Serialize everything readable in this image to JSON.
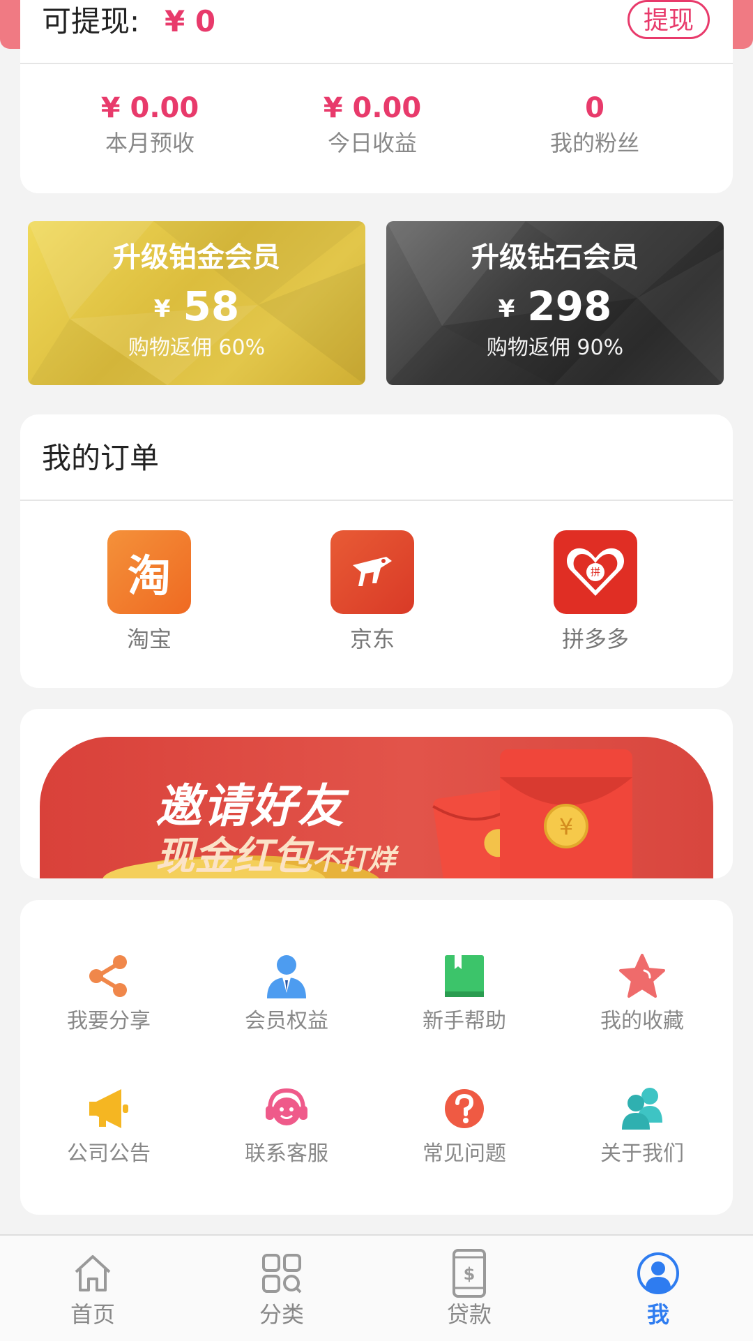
{
  "header": {
    "withdraw_label": "可提现:",
    "withdraw_amount": "¥ 0",
    "withdraw_button": "提现"
  },
  "stats": [
    {
      "value": "¥ 0.00",
      "label": "本月预收"
    },
    {
      "value": "¥ 0.00",
      "label": "今日收益"
    },
    {
      "value": "0",
      "label": "我的粉丝"
    }
  ],
  "memberships": [
    {
      "title": "升级铂金会员",
      "currency": "¥",
      "price": "58",
      "rebate": "购物返佣 60%"
    },
    {
      "title": "升级钻石会员",
      "currency": "¥",
      "price": "298",
      "rebate": "购物返佣 90%"
    }
  ],
  "orders": {
    "title": "我的订单",
    "shops": [
      {
        "name": "淘宝",
        "icon": "taobao-icon",
        "color": "#f37b2b",
        "glyph": "淘"
      },
      {
        "name": "京东",
        "icon": "jd-icon",
        "color": "#e0492f"
      },
      {
        "name": "拼多多",
        "icon": "pinduoduo-icon",
        "color": "#e02e24",
        "glyph": "拼"
      }
    ]
  },
  "invite": {
    "line1": "邀请好友",
    "line2": "现金红包",
    "line2_suffix": "不打烊",
    "coin_glyph": "¥"
  },
  "features": [
    {
      "label": "我要分享",
      "icon": "share-icon",
      "color": "#f0874a"
    },
    {
      "label": "会员权益",
      "icon": "member-icon",
      "color": "#4d9cf0"
    },
    {
      "label": "新手帮助",
      "icon": "book-icon",
      "color": "#3cc46a"
    },
    {
      "label": "我的收藏",
      "icon": "star-icon",
      "color": "#ef6b6b"
    },
    {
      "label": "公司公告",
      "icon": "megaphone-icon",
      "color": "#f5b622"
    },
    {
      "label": "联系客服",
      "icon": "headset-icon",
      "color": "#ef5a8a"
    },
    {
      "label": "常见问题",
      "icon": "question-icon",
      "color": "#ef5a43"
    },
    {
      "label": "关于我们",
      "icon": "team-icon",
      "color": "#3ec4c4"
    }
  ],
  "tabbar": [
    {
      "label": "首页",
      "icon": "home-icon"
    },
    {
      "label": "分类",
      "icon": "category-icon"
    },
    {
      "label": "贷款",
      "icon": "loan-icon",
      "glyph": "$"
    },
    {
      "label": "我",
      "icon": "profile-icon",
      "active": true
    }
  ]
}
